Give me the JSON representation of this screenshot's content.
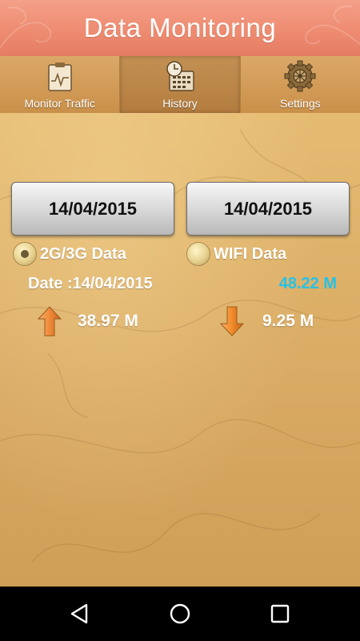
{
  "header": {
    "title": "Data Monitoring"
  },
  "tabs": [
    {
      "label": "Monitor Traffic",
      "icon": "clipboard-chart-icon",
      "active": false
    },
    {
      "label": "History",
      "icon": "clock-calendar-icon",
      "active": true
    },
    {
      "label": "Settings",
      "icon": "gear-icon",
      "active": false
    }
  ],
  "range": {
    "from": "14/04/2015",
    "to": "14/04/2015"
  },
  "data_type": {
    "options": [
      {
        "label": "2G/3G Data",
        "selected": true
      },
      {
        "label": "WIFI Data",
        "selected": false
      }
    ]
  },
  "summary": {
    "date_text": "Date :14/04/2015",
    "total": "48.22 M",
    "upload": "38.97 M",
    "download": "9.25 M"
  },
  "colors": {
    "header": "#ee8c72",
    "background": "#d9ad63",
    "total_text": "#25c2e8",
    "upload_arrow": "#f08a3a",
    "download_arrow": "#f28a2a"
  },
  "navbar": {
    "buttons": [
      "back-icon",
      "home-icon",
      "recents-icon"
    ]
  }
}
